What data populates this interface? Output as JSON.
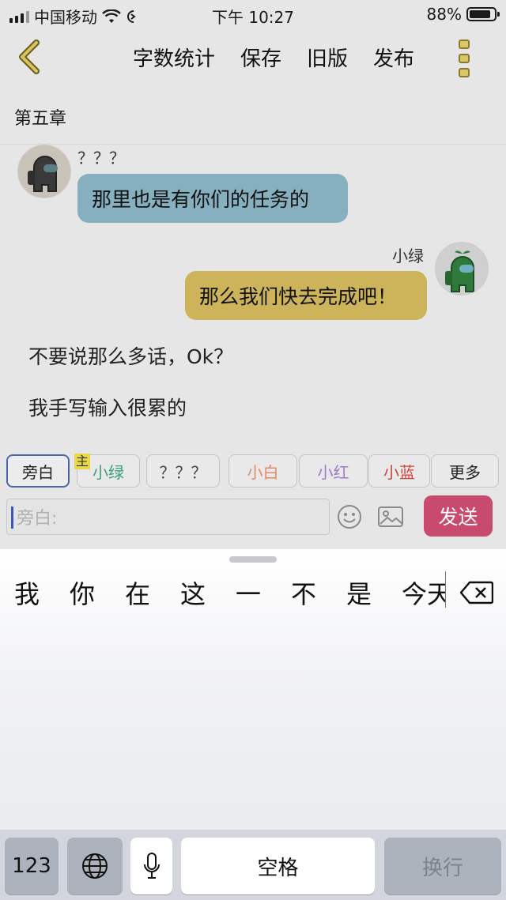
{
  "status_bar": {
    "carrier": "中国移动",
    "time": "下午 10:27",
    "battery": "88%"
  },
  "nav": {
    "actions": [
      "字数统计",
      "保存",
      "旧版",
      "发布"
    ]
  },
  "chapter_title": "第五章",
  "messages": [
    {
      "sender": "？？？",
      "text": "那里也是有你们的任务的"
    },
    {
      "sender": "小绿",
      "text": "那么我们快去完成吧！"
    }
  ],
  "narration": [
    "不要说那么多话，Ok？",
    "我手写输入很累的"
  ],
  "roles": [
    {
      "label": "旁白",
      "color": "#222222"
    },
    {
      "label": "小绿",
      "color": "#3aa27a"
    },
    {
      "label": "？？？",
      "color": "#444444"
    },
    {
      "label": "小白",
      "color": "#e08a6a"
    },
    {
      "label": "小红",
      "color": "#a07ac8"
    },
    {
      "label": "小蓝",
      "color": "#d0443a"
    },
    {
      "label": "更多",
      "color": "#222222"
    }
  ],
  "main_badge": "主",
  "composer": {
    "placeholder": "旁白:",
    "send_label": "发送"
  },
  "keyboard": {
    "candidates": [
      "我",
      "你",
      "在",
      "这",
      "一",
      "不",
      "是",
      "今天"
    ],
    "num_key": "123",
    "space_key": "空格",
    "return_key": "换行"
  },
  "colors": {
    "send_button": "#c84a6e",
    "bubble_left": "#86afbf",
    "bubble_right": "#cdb45a"
  }
}
